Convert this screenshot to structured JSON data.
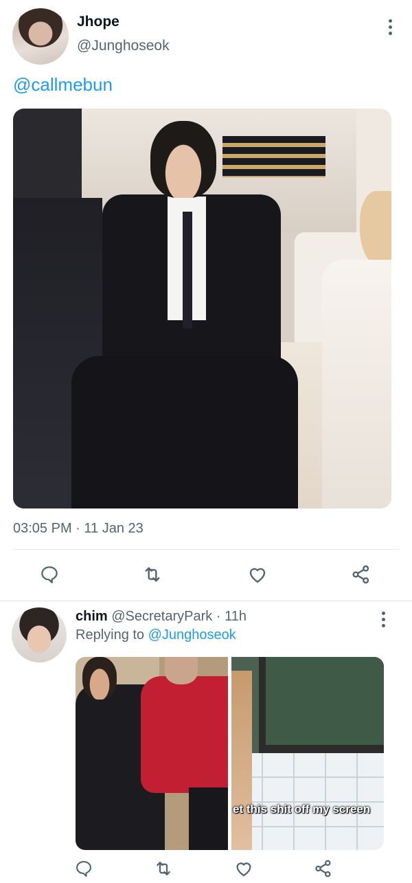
{
  "main_tweet": {
    "display_name": "Jhope",
    "handle": "@Junghoseok",
    "mention": "@callmebun",
    "timestamp": "03:05 PM · 11 Jan 23",
    "media_alt": "photo"
  },
  "reply_tweet": {
    "display_name": "chim",
    "handle": "@SecretaryPark",
    "separator": "·",
    "time_ago": "11h",
    "replying_label": "Replying to",
    "replying_handle": "@Junghoseok",
    "media_caption": "et this shit off my screen"
  },
  "icons": {
    "reply": "reply-bubble-icon",
    "retweet": "retweet-arrows-icon",
    "like": "heart-icon",
    "share": "share-nodes-icon",
    "more": "vertical-dots-icon"
  },
  "colors": {
    "accent": "#1d9bf0",
    "text_primary": "#0f1419",
    "text_secondary": "#536471",
    "divider": "#e6e9ec"
  }
}
